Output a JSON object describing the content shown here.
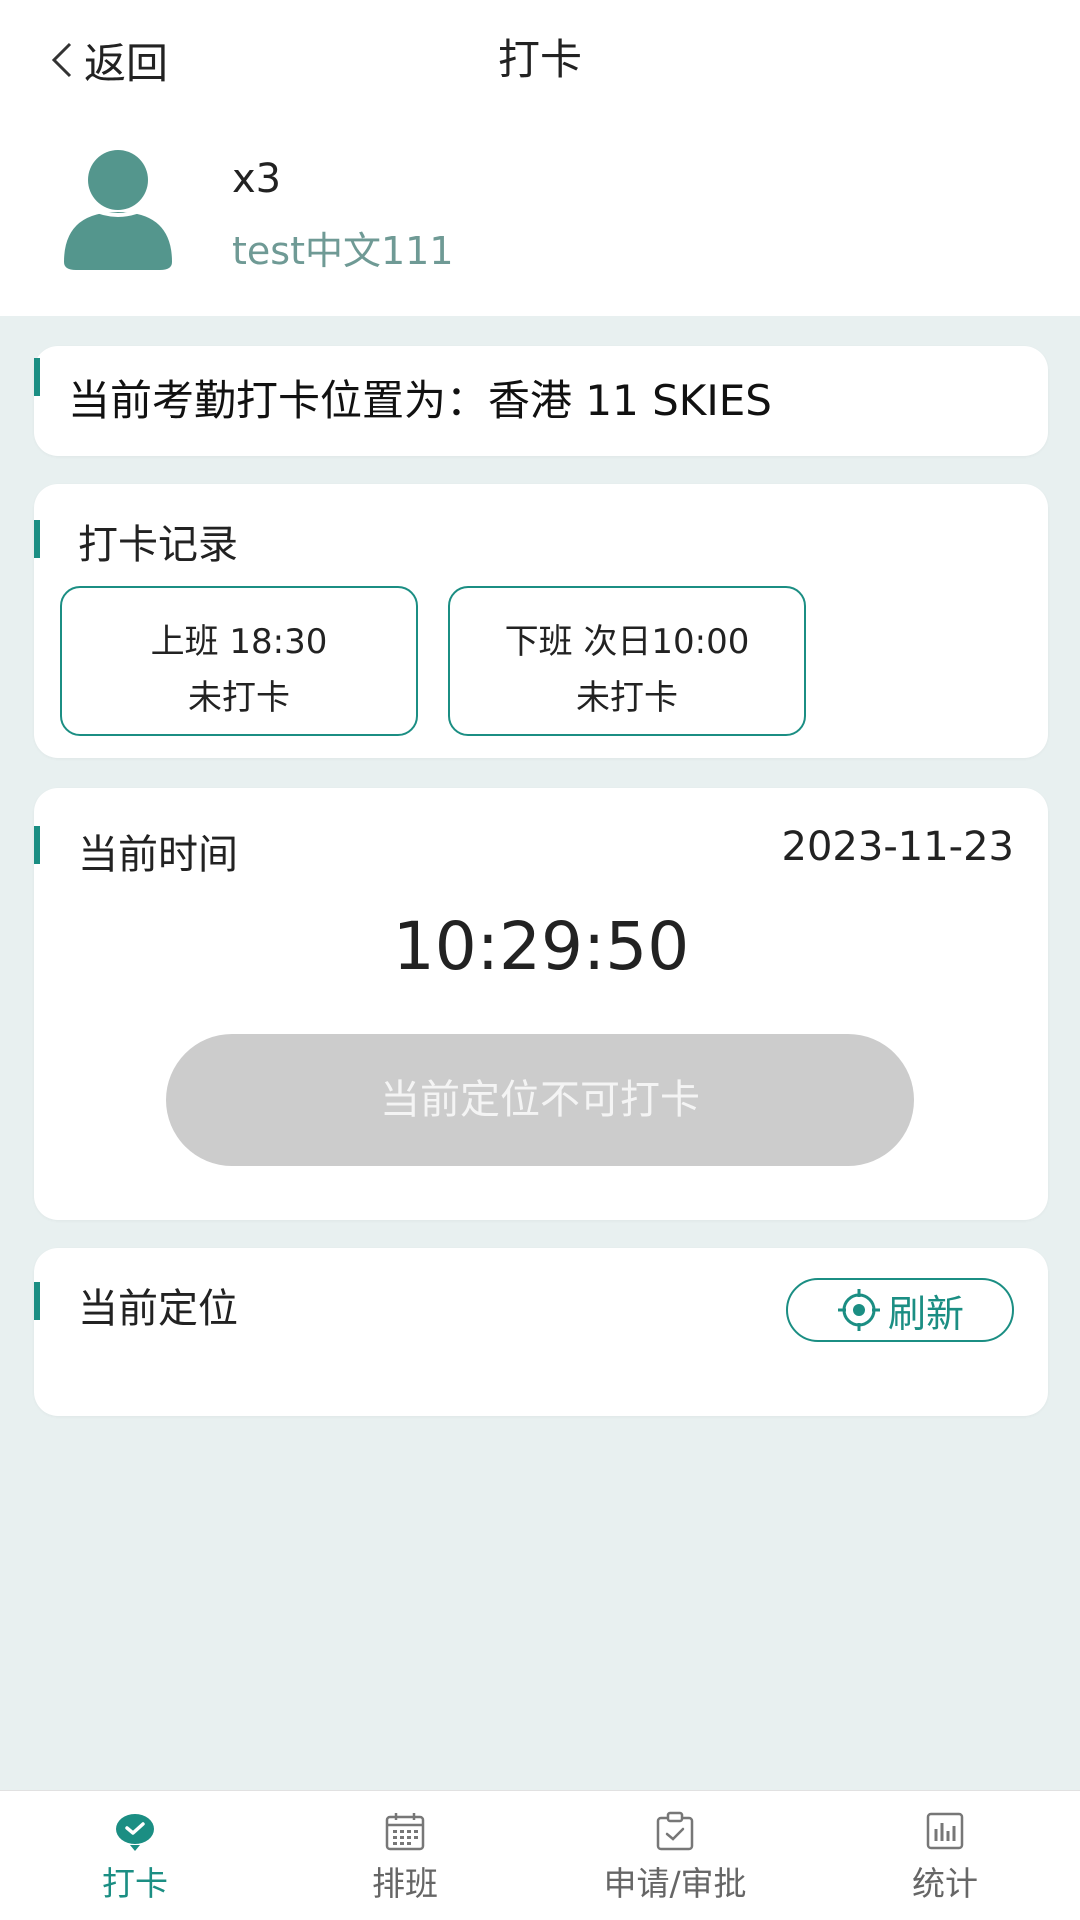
{
  "navbar": {
    "back_label": "返回",
    "title": "打卡"
  },
  "user": {
    "name": "x3",
    "org": "test中文111"
  },
  "location_banner": "当前考勤打卡位置为：香港 11 SKIES",
  "records": {
    "title": "打卡记录",
    "items": [
      {
        "line1": "上班 18:30",
        "line2": "未打卡"
      },
      {
        "line1": "下班 次日10:00",
        "line2": "未打卡"
      }
    ]
  },
  "time_section": {
    "title": "当前时间",
    "date": "2023-11-23",
    "time": "10:29:50",
    "punch_button": "当前定位不可打卡"
  },
  "position_section": {
    "title": "当前定位",
    "refresh_label": "刷新"
  },
  "tabbar": {
    "tabs": [
      {
        "label": "打卡",
        "icon": "punch-icon",
        "active": true
      },
      {
        "label": "排班",
        "icon": "calendar-icon",
        "active": false
      },
      {
        "label": "申请/审批",
        "icon": "clipboard-check-icon",
        "active": false
      },
      {
        "label": "统计",
        "icon": "bar-chart-icon",
        "active": false
      }
    ]
  },
  "colors": {
    "accent": "#1b8e83",
    "avatar": "#54968d",
    "disabled": "#cccccc",
    "background": "#e8f0f0"
  }
}
